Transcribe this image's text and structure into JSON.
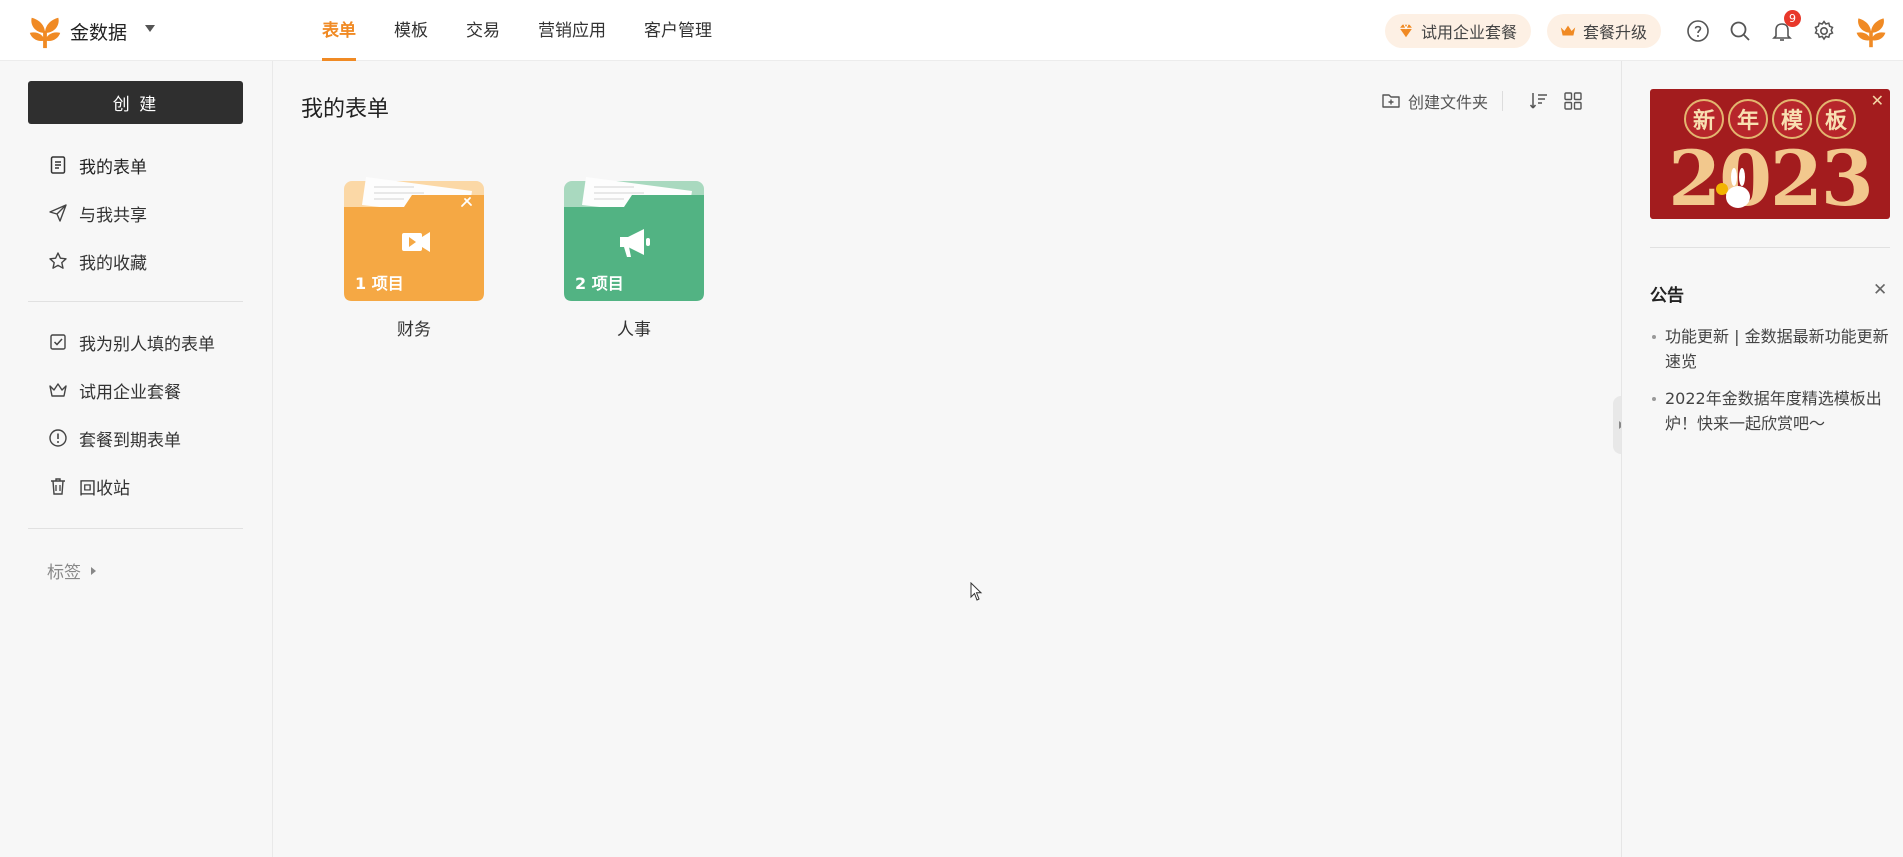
{
  "app": {
    "brand_name": "金数据",
    "accent_color": "#f08a24"
  },
  "nav": {
    "tabs": [
      {
        "label": "表单",
        "active": true
      },
      {
        "label": "模板",
        "active": false
      },
      {
        "label": "交易",
        "active": false
      },
      {
        "label": "营销应用",
        "active": false
      },
      {
        "label": "客户管理",
        "active": false
      }
    ]
  },
  "topright": {
    "trial_label": "试用企业套餐",
    "upgrade_label": "套餐升级",
    "notification_count": "9",
    "icons": [
      "help-icon",
      "search-icon",
      "bell-icon",
      "gear-icon",
      "avatar"
    ]
  },
  "sidebar": {
    "create_label": "创 建",
    "items": [
      {
        "label": "我的表单",
        "icon": "document-icon",
        "active": true
      },
      {
        "label": "与我共享",
        "icon": "send-icon",
        "active": false
      },
      {
        "label": "我的收藏",
        "icon": "star-icon",
        "active": false
      }
    ],
    "items2": [
      {
        "label": "我为别人填的表单",
        "icon": "checkbox-icon"
      },
      {
        "label": "试用企业套餐",
        "icon": "crown-icon"
      },
      {
        "label": "套餐到期表单",
        "icon": "alert-icon"
      },
      {
        "label": "回收站",
        "icon": "trash-icon"
      }
    ],
    "tags_label": "标签"
  },
  "main": {
    "title": "我的表单",
    "new_folder_label": "创建文件夹",
    "folders": [
      {
        "name": "财务",
        "count_label": "1 项目",
        "color": "#f5a844",
        "back_color": "#fbd8a6",
        "icon": "video-icon",
        "pinned": true
      },
      {
        "name": "人事",
        "count_label": "2 项目",
        "color": "#52b383",
        "back_color": "#a9d9bf",
        "icon": "megaphone-icon",
        "pinned": false
      }
    ]
  },
  "right_panel": {
    "banner": {
      "heading_chars": [
        "新",
        "年",
        "模",
        "板"
      ],
      "year": "2023"
    },
    "notice_title": "公告",
    "notices": [
      "功能更新 | 金数据最新功能更新速览",
      "2022年金数据年度精选模板出炉！快来一起欣赏吧～"
    ]
  }
}
